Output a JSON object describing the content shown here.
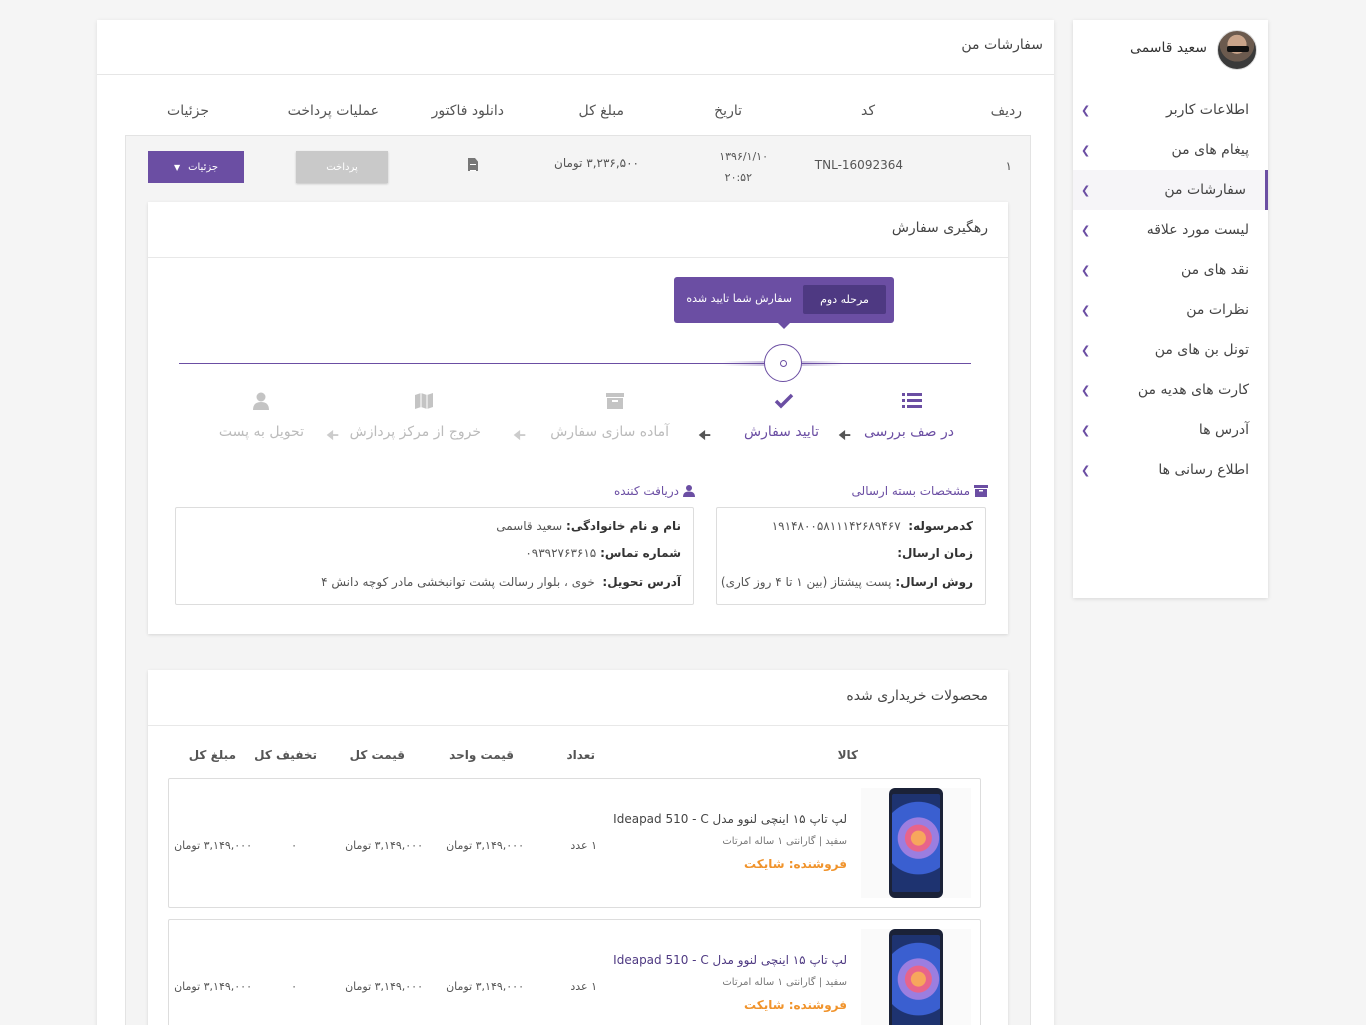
{
  "user": {
    "name": "سعید قاسمی"
  },
  "sidebar": {
    "items": [
      {
        "label": "اطلاعات کاربر"
      },
      {
        "label": "پیغام های من"
      },
      {
        "label": "سفارشات من"
      },
      {
        "label": "لیست مورد علاقه"
      },
      {
        "label": "نقد های من"
      },
      {
        "label": "نظرات من"
      },
      {
        "label": "تونل بن های من"
      },
      {
        "label": "کارت های هدیه من"
      },
      {
        "label": "آدرس ها"
      },
      {
        "label": "اطلاع رسانی ها"
      }
    ],
    "active_index": 2
  },
  "orders": {
    "title": "سفارشات من",
    "headers": {
      "row": "ردیف",
      "code": "کد",
      "date": "تاریخ",
      "total": "مبلغ کل",
      "invoice": "دانلود فاکتور",
      "payment": "عملیات پرداخت",
      "details": "جزئیات"
    },
    "order": {
      "row": "۱",
      "code": "TNL-16092364",
      "date": "۱۳۹۶/۱/۱۰",
      "time": "۲۰:۵۲",
      "total": "۳,۲۳۶,۵۰۰ تومان",
      "pay_label": "پرداخت",
      "details_label": "جزئیات"
    }
  },
  "tracking": {
    "title": "رهگیری سفارش",
    "tooltip": {
      "badge": "مرحله دوم",
      "text": "سفارش شما تایید شده"
    },
    "steps": [
      {
        "label": "در صف بررسی",
        "icon": "list-icon"
      },
      {
        "label": "تایید سفارش",
        "icon": "check-icon"
      },
      {
        "label": "آماده سازی سفارش",
        "icon": "archive-box-icon"
      },
      {
        "label": "خروج از مرکز پردازش",
        "icon": "map-icon"
      },
      {
        "label": "تحویل به پست",
        "icon": "user-icon"
      }
    ],
    "package": {
      "title": "مشخصات بسته ارسالی",
      "code_label": "کدمرسوله:",
      "code": "۱۹۱۴۸۰۰۵۸۱۱۱۴۲۶۸۹۴۶۷",
      "time_label": "زمان ارسال:",
      "time": "",
      "method_label": "روش ارسال:",
      "method": "پست پیشتاز (بین ۱ تا ۴ روز کاری)"
    },
    "receiver": {
      "title": "دریافت کننده",
      "name_label": "نام و نام خانوادگی:",
      "name": "سعید قاسمی",
      "phone_label": "شماره تماس:",
      "phone": "۰۹۳۹۲۷۶۳۶۱۵",
      "address_label": "آدرس تحویل:",
      "address": "خوی ، بلوار رسالت پشت توانبخشی مادر کوچه دانش ۴"
    }
  },
  "products": {
    "title": "محصولات خریداری شده",
    "headers": {
      "item": "کالا",
      "qty": "تعداد",
      "unit": "قیمت واحد",
      "price": "قیمت کل",
      "discount": "تخفیف کل",
      "total": "مبلغ کل"
    },
    "rows": [
      {
        "name": "Ideapad 510 - C لپ تاپ ۱۵ اینچی لنوو مدل",
        "meta": "سفید | گارانتی ۱ ساله امرتات",
        "seller": "فروشنده: شایکت",
        "qty": "۱ عدد",
        "unit": "۳,۱۴۹,۰۰۰ تومان",
        "price": "۳,۱۴۹,۰۰۰ تومان",
        "discount": "۰",
        "total": "۳,۱۴۹,۰۰۰ تومان"
      },
      {
        "name": "Ideapad 510 - C لپ تاپ ۱۵ اینچی لنوو مدل",
        "meta": "سفید | گارانتی ۱ ساله امرتات",
        "seller": "فروشنده: شایکت",
        "qty": "۱ عدد",
        "unit": "۳,۱۴۹,۰۰۰ تومان",
        "price": "۳,۱۴۹,۰۰۰ تومان",
        "discount": "۰",
        "total": "۳,۱۴۹,۰۰۰ تومان"
      }
    ]
  },
  "colors": {
    "accent": "#6b4ea3",
    "accent_dark": "#4e3982",
    "seller": "#f0932b",
    "inactive": "#c4c4c4"
  }
}
